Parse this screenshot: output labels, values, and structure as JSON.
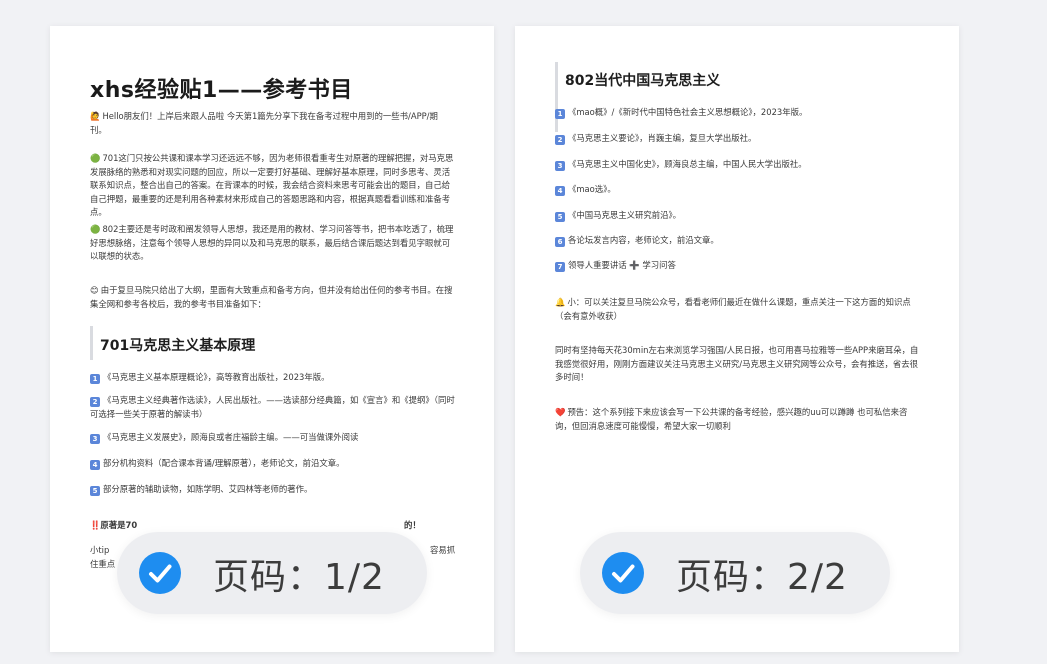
{
  "page1": {
    "title": "xhs经验贴1——参考书目",
    "intro": "Hello朋友们！上岸后来跟人品啦 今天第1篇先分享下我在备考过程中用到的一些书/APP/期刊。",
    "p701": "701这门只按公共课和课本学习还远远不够，因为老师很看重考生对原著的理解把握，对马克思发展脉络的熟悉和对现实问题的回应，所以一定要打好基础、理解好基本原理，同时多思考、灵活联系知识点，整合出自己的答案。在背课本的时候，我会结合资料来思考可能会出的题目，自己给自己押题，最重要的还是利用各种素材来形成自己的答题思路和内容，根据真题看看训练和准备考点。",
    "p802": "802主要还是考时政和阐发领导人思想，我还是用的教材、学习问答等书，把书本吃透了，梳理好思想脉络，注意每个领导人思想的异同以及和马克思的联系，最后结合课后题达到看见字眼就可以联想的状态。",
    "p_outline": "由于复旦马院只给出了大纲，里面有大致重点和备考方向，但并没有给出任何的参考书目。在搜集全网和参考各校后，我的参考书目准备如下：",
    "section_title": "701马克思主义基本原理",
    "items": [
      {
        "num": "1",
        "text": "《马克思主义基本原理概论》，高等教育出版社，2023年版。"
      },
      {
        "num": "2",
        "text": "《马克思主义经典著作选读》，人民出版社。——选读部分经典篇，如《宣言》和《提纲》（同时可选择一些关于原著的解读书）"
      },
      {
        "num": "3",
        "text": "《马克思主义发展史》，顾海良或者庄福龄主编。——可当做课外阅读"
      },
      {
        "num": "4",
        "text": "部分机构资料（配合课本背诵/理解原著），老师论文，前沿文章。"
      },
      {
        "num": "5",
        "text": "部分原著的辅助读物，如陈学明、艾四林等老师的著作。"
      }
    ],
    "note_fragment": "‼️原著是70",
    "note_tail": "的！",
    "tip_fragment": "小tip",
    "tip_tail": "容易抓",
    "tip_line2": "住重点"
  },
  "page2": {
    "section_title": "802当代中国马克思主义",
    "items": [
      {
        "num": "1",
        "text": "《mao概》/《新时代中国特色社会主义思想概论》，2023年版。"
      },
      {
        "num": "2",
        "text": "《马克思主义要论》，肖巍主编，复旦大学出版社。"
      },
      {
        "num": "3",
        "text": "《马克思主义中国化史》，顾海良总主编，中国人民大学出版社。"
      },
      {
        "num": "4",
        "text": "《mao选》。"
      },
      {
        "num": "5",
        "text": "《中国马克思主义研究前沿》。"
      },
      {
        "num": "6",
        "text": "各论坛发言内容，老师论文，前沿文章。"
      },
      {
        "num": "7",
        "text": "领导人重要讲话 ➕ 学习问答"
      }
    ],
    "tip": "小：可以关注复旦马院公众号，看看老师们最近在做什么课题，重点关注一下这方面的知识点（会有意外收获）",
    "daily": "同时有坚持每天花30min左右来浏览学习强国/人民日报，也可用喜马拉雅等一些APP来磨耳朵，自我感觉很好用，刚刚方面建议关注马克思主义研究/马克思主义研究网等公众号，会有推送，省去很多时间！",
    "preview": "预告：这个系列接下来应该会写一下公共课的备考经验，感兴趣的uu可以蹲蹲 也可私信来咨询，但回消息速度可能慢慢，希望大家一切顺利"
  },
  "badges": [
    {
      "label": "页码：1/2"
    },
    {
      "label": "页码：2/2"
    }
  ],
  "colors": {
    "check": "#1e8df0",
    "number_badge": "#5b86d9"
  }
}
